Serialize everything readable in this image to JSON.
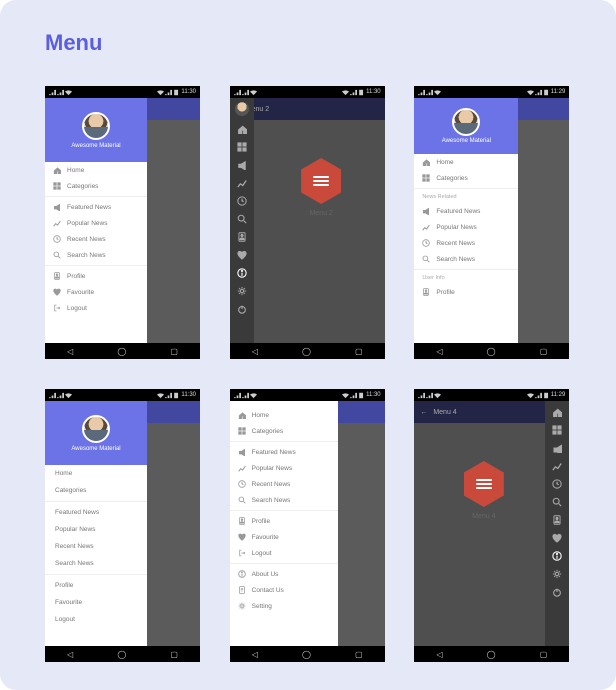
{
  "page_title": "Menu",
  "status": {
    "time": "11:30",
    "time_alt": "11:29"
  },
  "drawer_title": "Awesome Material",
  "items": {
    "home": "Home",
    "categories": "Categories",
    "featured": "Featured News",
    "popular": "Popular News",
    "recent": "Recent News",
    "search": "Search News",
    "profile": "Profile",
    "favourite": "Favourite",
    "logout": "Logout",
    "about": "About Us",
    "contact": "Contact Us",
    "setting": "Setting"
  },
  "sections": {
    "news": "News Related",
    "user": "User Info"
  },
  "screens": {
    "menu2": "Menu 2",
    "menu2_body": "Menu 2",
    "menu4": "Menu 4",
    "menu4_body": "Menu 4"
  }
}
